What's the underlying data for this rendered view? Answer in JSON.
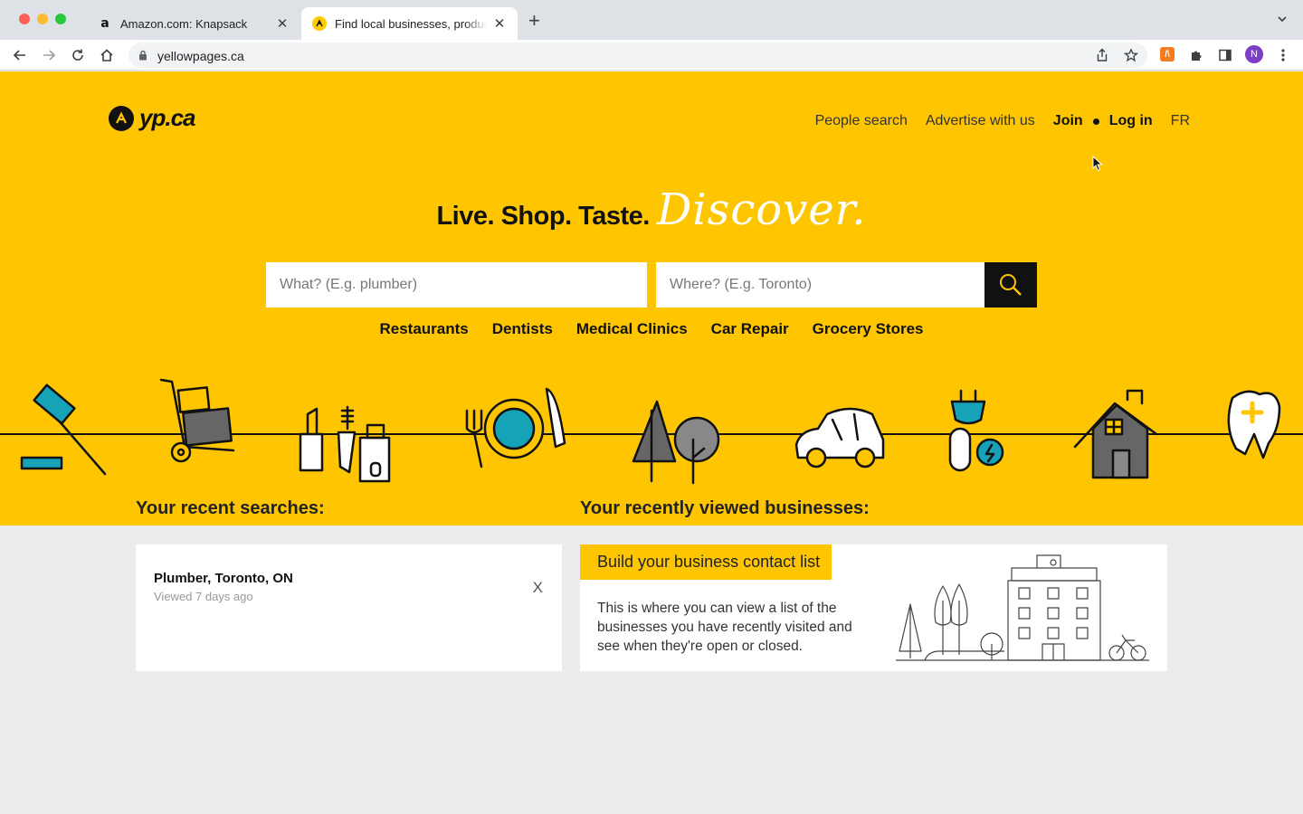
{
  "browser": {
    "tabs": [
      {
        "title": "Amazon.com: Knapsack",
        "favicon": "amazon-a-icon",
        "active": false
      },
      {
        "title": "Find local businesses, products",
        "favicon": "yp-icon",
        "active": true
      }
    ],
    "url": "yellowpages.ca",
    "profile_initial": "N",
    "extension_label": "/\\"
  },
  "header": {
    "logo_text": "yp.ca",
    "nav": {
      "people_search": "People search",
      "advertise": "Advertise with us",
      "join": "Join",
      "login": "Log in",
      "language": "FR"
    }
  },
  "hero": {
    "tagline_bold": "Live. Shop. Taste.",
    "tagline_script": "Discover."
  },
  "search": {
    "what_placeholder": "What? (E.g. plumber)",
    "where_placeholder": "Where? (E.g. Toronto)"
  },
  "categories": [
    "Restaurants",
    "Dentists",
    "Medical Clinics",
    "Car Repair",
    "Grocery Stores"
  ],
  "recent_searches": {
    "title": "Your recent searches:",
    "items": [
      {
        "query": "Plumber, Toronto, ON",
        "viewed": "Viewed 7 days ago",
        "remove": "X"
      }
    ]
  },
  "recent_businesses": {
    "title": "Your recently viewed businesses:",
    "banner": "Build your business contact list",
    "description": "This is where you can view a list of the businesses you have recently visited and see when they're open or closed."
  },
  "colors": {
    "brand_yellow": "#ffc600",
    "teal_accent": "#16a3b8",
    "page_bg": "#ececec"
  }
}
